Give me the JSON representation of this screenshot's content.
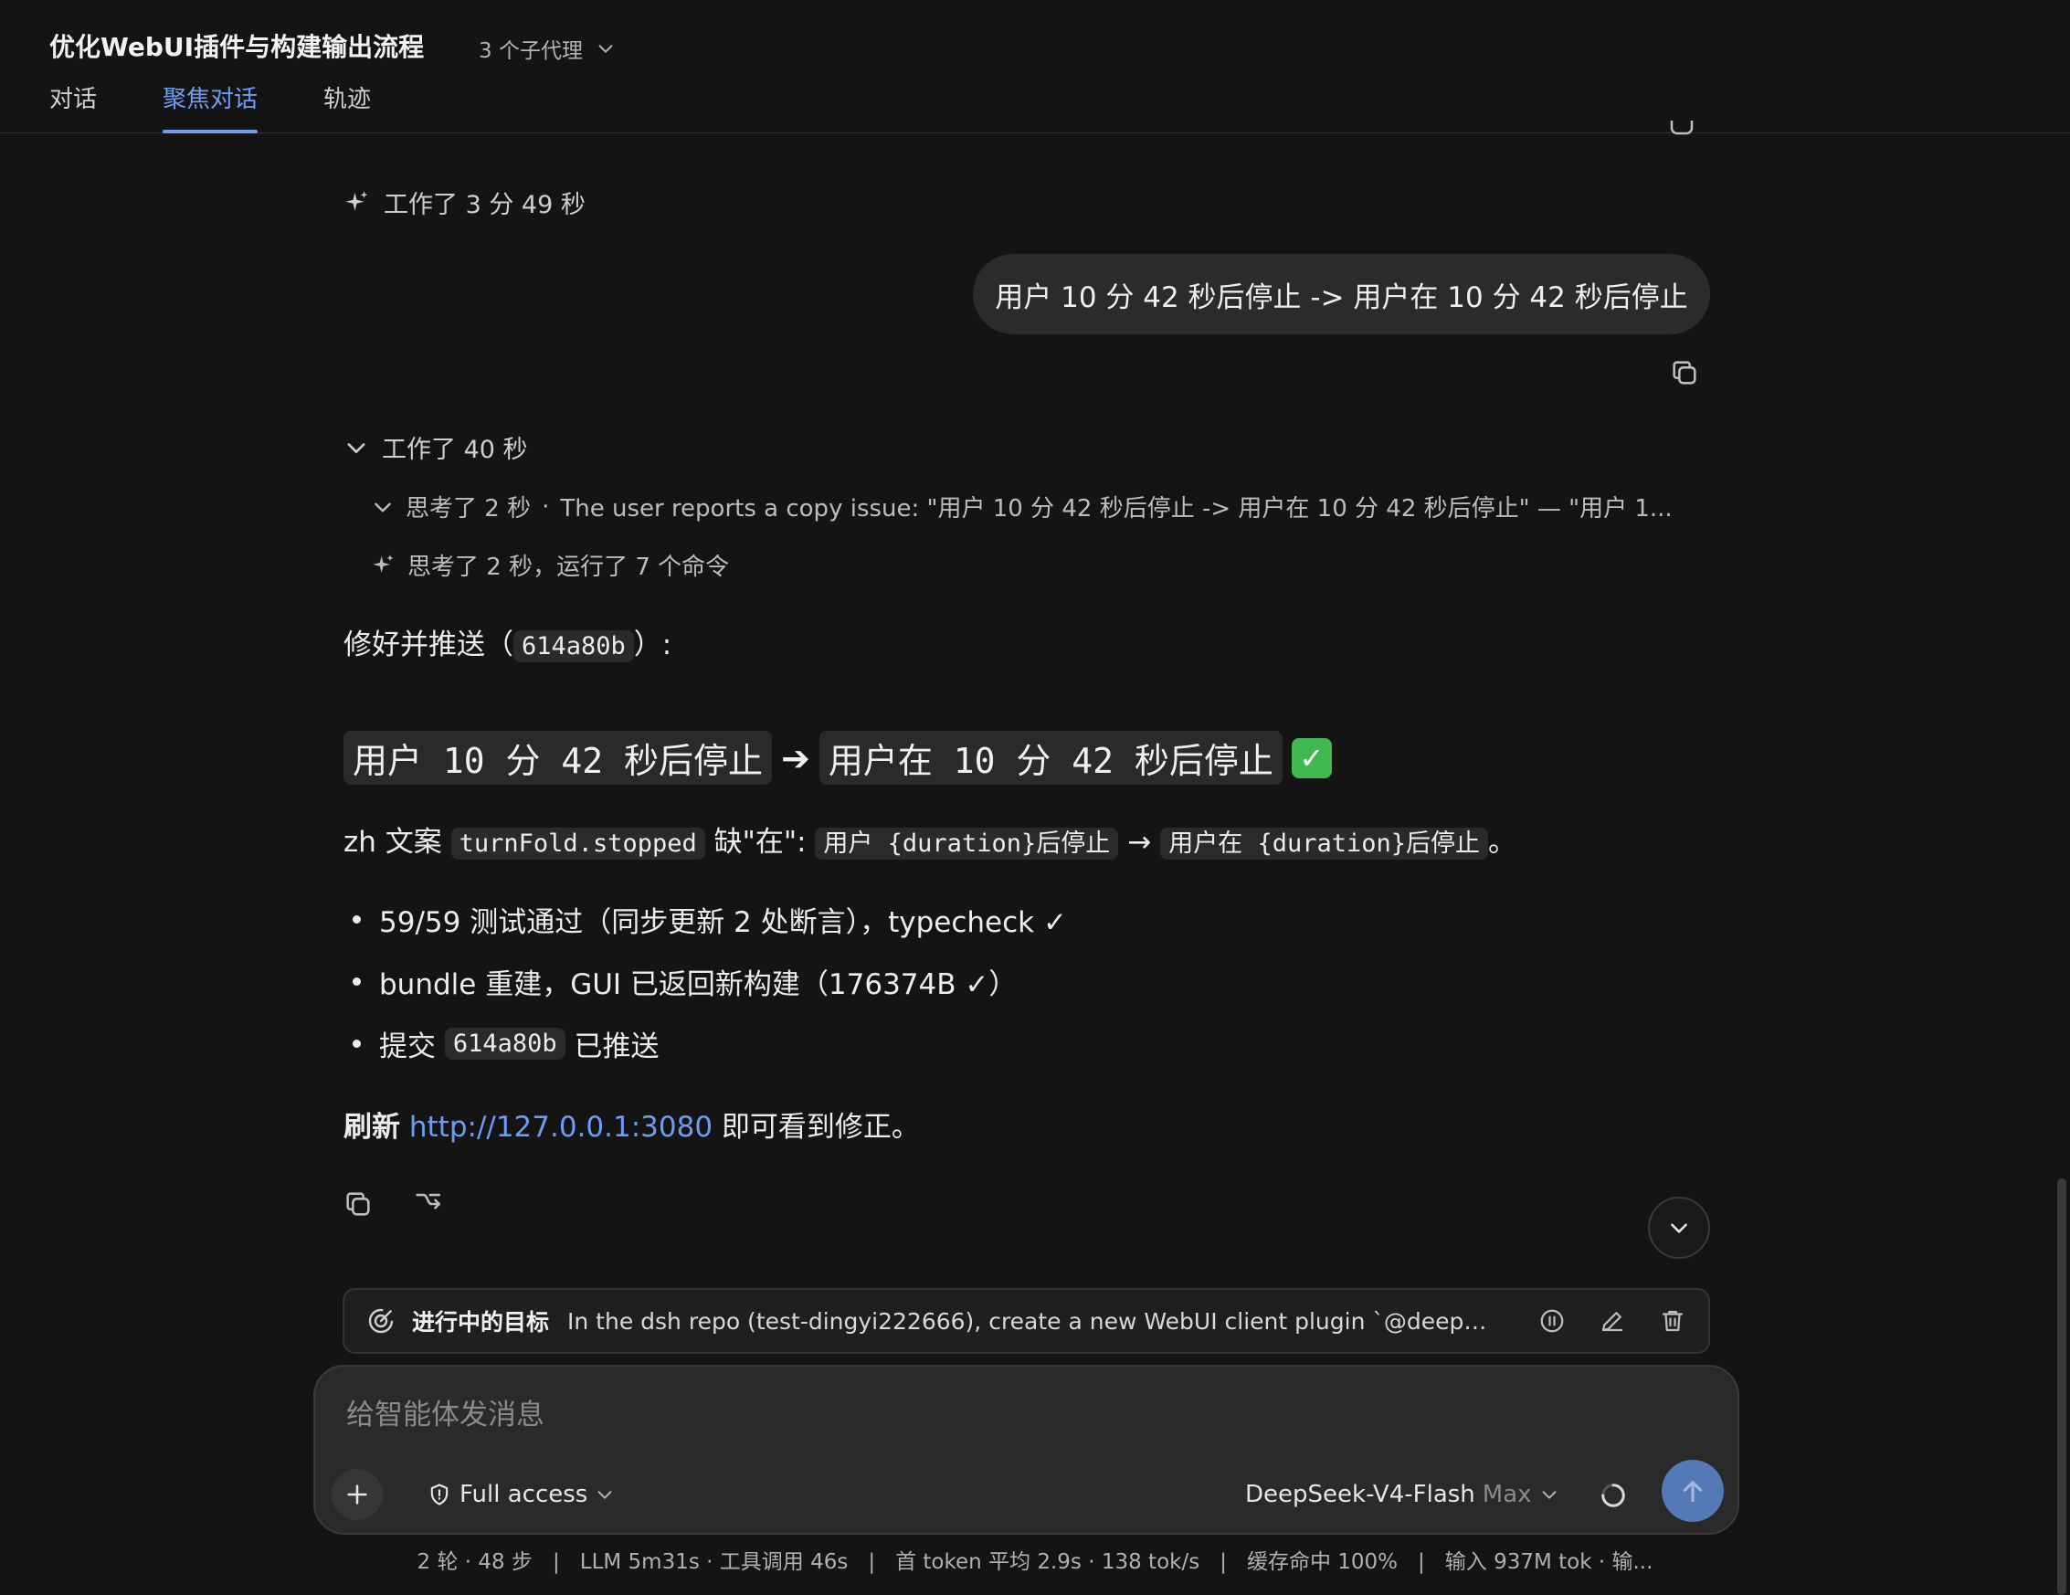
{
  "header": {
    "title": "优化WebUI插件与构建输出流程",
    "subagents_label": "3 个子代理",
    "tabs": [
      {
        "label": "对话"
      },
      {
        "label": "聚焦对话"
      },
      {
        "label": "轨迹"
      }
    ]
  },
  "conversation": {
    "worked_1": "工作了 3 分 49 秒",
    "user_message": "用户 10 分 42 秒后停止 -> 用户在 10 分 42 秒后停止",
    "worked_2": "工作了 40 秒",
    "thought_1_label": "思考了 2 秒",
    "thought_1_summary": "The user reports a copy issue: \"用户 10 分 42 秒后停止 -> 用户在 10 分 42 秒后停止\" — \"用户 1...",
    "thought_2_label": "思考了 2 秒，运行了 7 个命令",
    "reply": {
      "intro_prefix": "修好并推送（",
      "intro_code": "614a80b",
      "intro_suffix": "）:",
      "heading_before": "用户 10 分 42 秒后停止",
      "heading_arrow": "➔",
      "heading_after": "用户在 10 分 42 秒后停止",
      "heading_check": "✓",
      "line_prefix": "zh 文案 ",
      "line_code_key": "turnFold.stopped",
      "line_mid": " 缺\"在\": ",
      "line_code_old": "用户 {duration}后停止",
      "line_arrow": "→",
      "line_code_new": "用户在 {duration}后停止",
      "line_end": "。",
      "bullets": [
        {
          "text": "59/59 测试通过（同步更新 2 处断言），typecheck ✓"
        },
        {
          "text": "bundle 重建，GUI 已返回新构建（176374B ✓）"
        },
        {
          "prefix": "提交 ",
          "code": "614a80b",
          "suffix": " 已推送"
        }
      ],
      "refresh_bold": "刷新",
      "refresh_link": "http://127.0.0.1:3080",
      "refresh_suffix": " 即可看到修正。"
    }
  },
  "goal": {
    "label": "进行中的目标",
    "text": "In the dsh repo (test-dingyi222666), create a new WebUI client plugin `@deepse..."
  },
  "composer": {
    "placeholder": "给智能体发消息",
    "access_label": "Full access",
    "model_name": "DeepSeek-V4-Flash",
    "model_effort": "Max"
  },
  "stats": {
    "turns": "2 轮 · 48 步",
    "llm": "LLM 5m31s · 工具调用 46s",
    "first_token": "首 token 平均 2.9s · 138 tok/s",
    "cache": "缓存命中 100%",
    "input": "输入 937M tok · 输..."
  },
  "colors": {
    "background": "#141414",
    "accent": "#6e9cf2",
    "send_button": "#5578b6",
    "success": "#3fb950"
  },
  "icons": [
    "chevron-down-icon",
    "sparkle-icon",
    "copy-icon",
    "branch-icon",
    "target-icon",
    "pause-icon",
    "edit-icon",
    "trash-icon",
    "plus-icon",
    "shield-icon",
    "spinner-icon",
    "arrow-up-icon"
  ]
}
